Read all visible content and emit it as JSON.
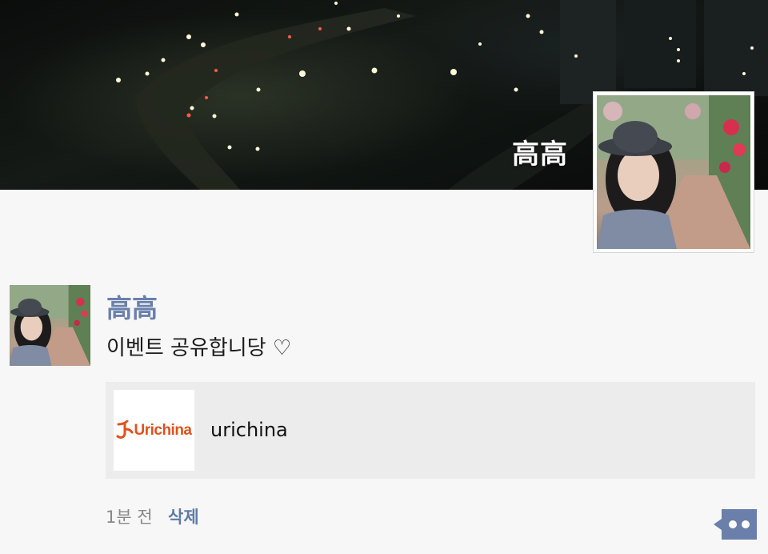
{
  "profile": {
    "name": "高高"
  },
  "post": {
    "author": "高高",
    "text": "이벤트 공유합니당 ♡",
    "link_card": {
      "logo_text": "Urichina",
      "title": "urichina"
    },
    "time": "1분 전",
    "delete_label": "삭제"
  },
  "colors": {
    "author_link": "#6a80ac",
    "delete_link": "#5f7aa8",
    "chat_button": "#6a7faa",
    "logo_orange": "#e0511d"
  },
  "icons": {
    "chat": "chat-bubble-icon"
  }
}
